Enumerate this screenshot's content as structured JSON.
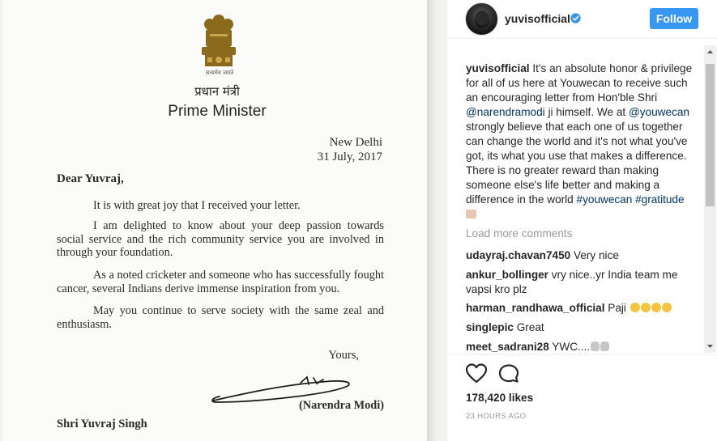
{
  "letter": {
    "emblem_motto": "सत्यमेव जयते",
    "office_hindi": "प्रधान मंत्री",
    "office_english": "Prime Minister",
    "place": "New Delhi",
    "date": "31 July, 2017",
    "salutation": "Dear Yuvraj,",
    "paragraphs": [
      "It is with great joy that I received your letter.",
      "I am delighted to know about your deep passion towards social service and the rich community service you are involved in through your foundation.",
      "As a noted cricketer and someone who has successfully fought cancer, several Indians derive immense inspiration from you.",
      "May you continue to serve society with the same zeal and enthusiasm."
    ],
    "closing": "Yours,",
    "signer": "(Narendra Modi)",
    "addressee": "Shri Yuvraj Singh"
  },
  "post": {
    "username": "yuvisofficial",
    "follow_label": "Follow",
    "caption": {
      "user": "yuvisofficial",
      "text_1": " It's an absolute honor & privilege for all of us here at Youwecan to receive such an encouraging letter from Hon'ble Shri ",
      "mention_1": "@narendramodi",
      "text_2": " ji himself. We at ",
      "mention_2": "@youwecan",
      "text_3": " strongly believe that each one of us together can change the world and it's not what you've got, its what you use that makes a difference. There is no greater reward than making someone else's life better and making a difference in the world ",
      "hashtag_1": "#youwecan",
      "hashtag_2": "#gratitude"
    },
    "load_more_label": "Load more comments",
    "comments": [
      {
        "user": "udayraj.chavan7450",
        "text": " Very nice"
      },
      {
        "user": "ankur_bollinger",
        "text": " vry nice..yr India team me vapsi kro plz"
      },
      {
        "user": "harman_randhawa_official",
        "text": " Paji "
      },
      {
        "user": "singlepic",
        "text": " Great"
      },
      {
        "user": "meet_sadrani28",
        "text": " YWC...."
      }
    ],
    "likes": "178,420 likes",
    "timestamp": "23 HOURS AGO"
  },
  "colors": {
    "accent": "#3897f0",
    "tag": "#003569",
    "muted": "#999999",
    "text": "#262626"
  },
  "icons": [
    "verified-badge-icon",
    "heart-icon",
    "comment-bubble-icon",
    "scroll-up-arrow-icon",
    "scroll-down-arrow-icon",
    "state-emblem-icon",
    "signature-graphic"
  ]
}
